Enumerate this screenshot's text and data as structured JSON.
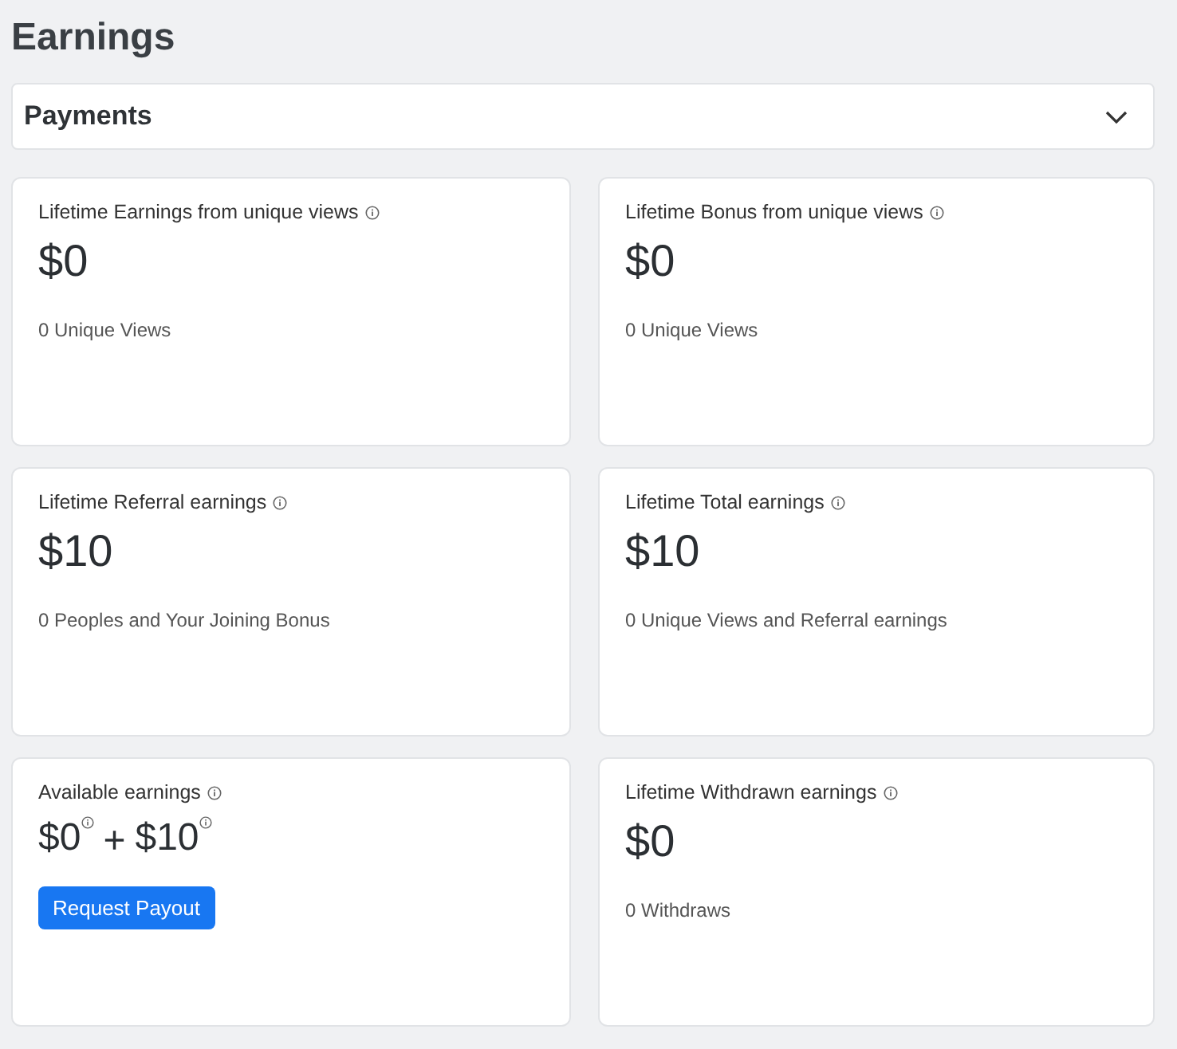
{
  "title": "Earnings",
  "accordion": {
    "label": "Payments",
    "expanded": false
  },
  "cards": [
    {
      "kind": "stat",
      "label": "Lifetime Earnings from unique views",
      "amount": "$0",
      "note": "0 Unique Views"
    },
    {
      "kind": "stat",
      "label": "Lifetime Bonus from unique views",
      "amount": "$0",
      "note": "0 Unique Views"
    },
    {
      "kind": "stat",
      "label": "Lifetime Referral earnings",
      "amount": "$10",
      "note": "0 Peoples and Your Joining Bonus"
    },
    {
      "kind": "stat",
      "label": "Lifetime Total earnings",
      "amount": "$10",
      "note": "0 Unique Views and Referral earnings"
    },
    {
      "kind": "payout",
      "label": "Available earnings",
      "amounts": [
        "$0",
        "$10"
      ],
      "plus": "+",
      "button": "Request Payout"
    },
    {
      "kind": "stat",
      "label": "Lifetime Withdrawn earnings",
      "amount": "$0",
      "note": "0 Withdraws"
    }
  ]
}
